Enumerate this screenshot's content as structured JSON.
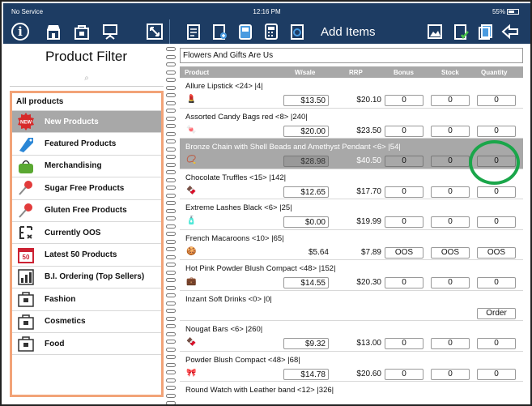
{
  "status": {
    "carrier": "No Service",
    "time": "12:16 PM",
    "battery": "55%"
  },
  "toolbar": {
    "title": "Add Items",
    "left_icons": [
      "info-icon",
      "store-icon",
      "bag-icon",
      "presentation-icon",
      "expand-icon"
    ],
    "right_icons": [
      "image-icon",
      "checklist-icon",
      "copy-icon",
      "back-arrow-icon"
    ]
  },
  "filter": {
    "title": "Product Filter",
    "search_glyph": "⌕",
    "items": [
      {
        "label": "All products"
      },
      {
        "label": "New Products",
        "badge": "NEW",
        "selected": true
      },
      {
        "label": "Featured Products"
      },
      {
        "label": "Merchandising"
      },
      {
        "label": "Sugar Free Products"
      },
      {
        "label": "Gluten Free Products"
      },
      {
        "label": "Currently OOS"
      },
      {
        "label": "Latest 50 Products",
        "badge": "50"
      },
      {
        "label": "B.I. Ordering (Top Sellers)"
      },
      {
        "label": "Fashion"
      },
      {
        "label": "Cosmetics"
      },
      {
        "label": "Food"
      }
    ]
  },
  "order": {
    "customer": "Flowers And Gifts Are Us",
    "columns": {
      "product": "Product",
      "wsale": "W/sale",
      "rrp": "RRP",
      "bonus": "Bonus",
      "stock": "Stock",
      "quantity": "Quantity"
    },
    "rows": [
      {
        "name": "Allure Lipstick <24> |4|",
        "wsale": "$13.50",
        "rrp": "$20.10",
        "bonus": "0",
        "stock": "0",
        "qty": "0",
        "flag": "!",
        "thumb": "💄"
      },
      {
        "name": "Assorted Candy Bags red <8> |240|",
        "wsale": "$20.00",
        "rrp": "$23.50",
        "bonus": "0",
        "stock": "0",
        "qty": "0",
        "thumb": "🍬"
      },
      {
        "name": "Bronze Chain with Shell Beads and Amethyst Pendant <6> |54|",
        "wsale": "$28.98",
        "rrp": "$40.50",
        "bonus": "0",
        "stock": "0",
        "qty": "0",
        "selected": true,
        "thumb": "📿"
      },
      {
        "name": "Chocolate Truffles <15> |142|",
        "wsale": "$12.65",
        "rrp": "$17.70",
        "bonus": "0",
        "stock": "0",
        "qty": "0",
        "thumb": "🍫"
      },
      {
        "name": "Extreme Lashes Black <6> |25|",
        "wsale": "$0.00",
        "rrp": "$19.99",
        "bonus": "0",
        "stock": "0",
        "qty": "0",
        "thumb": "🧴"
      },
      {
        "name": "French Macaroons <10> |65|",
        "wsale": "$5.64",
        "rrp": "$7.89",
        "bonus": "OOS",
        "stock": "OOS",
        "qty": "OOS",
        "plain_prices": true,
        "thumb": "🍪"
      },
      {
        "name": "Hot Pink Powder Blush Compact <48> |152|",
        "wsale": "$14.55",
        "rrp": "$20.30",
        "bonus": "0",
        "stock": "0",
        "qty": "0",
        "thumb": "💼"
      },
      {
        "name": "Inzant Soft Drinks <0> |0|",
        "wsale": "",
        "rrp": "",
        "bonus": "",
        "stock": "",
        "qty": "Order",
        "no_fields": true
      },
      {
        "name": "Nougat Bars <6> |260|",
        "wsale": "$9.32",
        "rrp": "$13.00",
        "bonus": "0",
        "stock": "0",
        "qty": "0",
        "thumb": "🍫"
      },
      {
        "name": "Powder Blush Compact <48> |68|",
        "wsale": "$14.78",
        "rrp": "$20.60",
        "bonus": "0",
        "stock": "0",
        "qty": "0",
        "thumb": "🎀"
      },
      {
        "name": "Round Watch with Leather band <12> |326|",
        "wsale": "",
        "rrp": "",
        "bonus": "",
        "stock": "",
        "qty": "",
        "no_fields": true
      }
    ]
  },
  "colors": {
    "bar": "#1d3c63",
    "selected": "#a8a8a8",
    "filter_border": "#f2a378",
    "annotation": "#1aa64a",
    "flag": "#d61f1f"
  }
}
